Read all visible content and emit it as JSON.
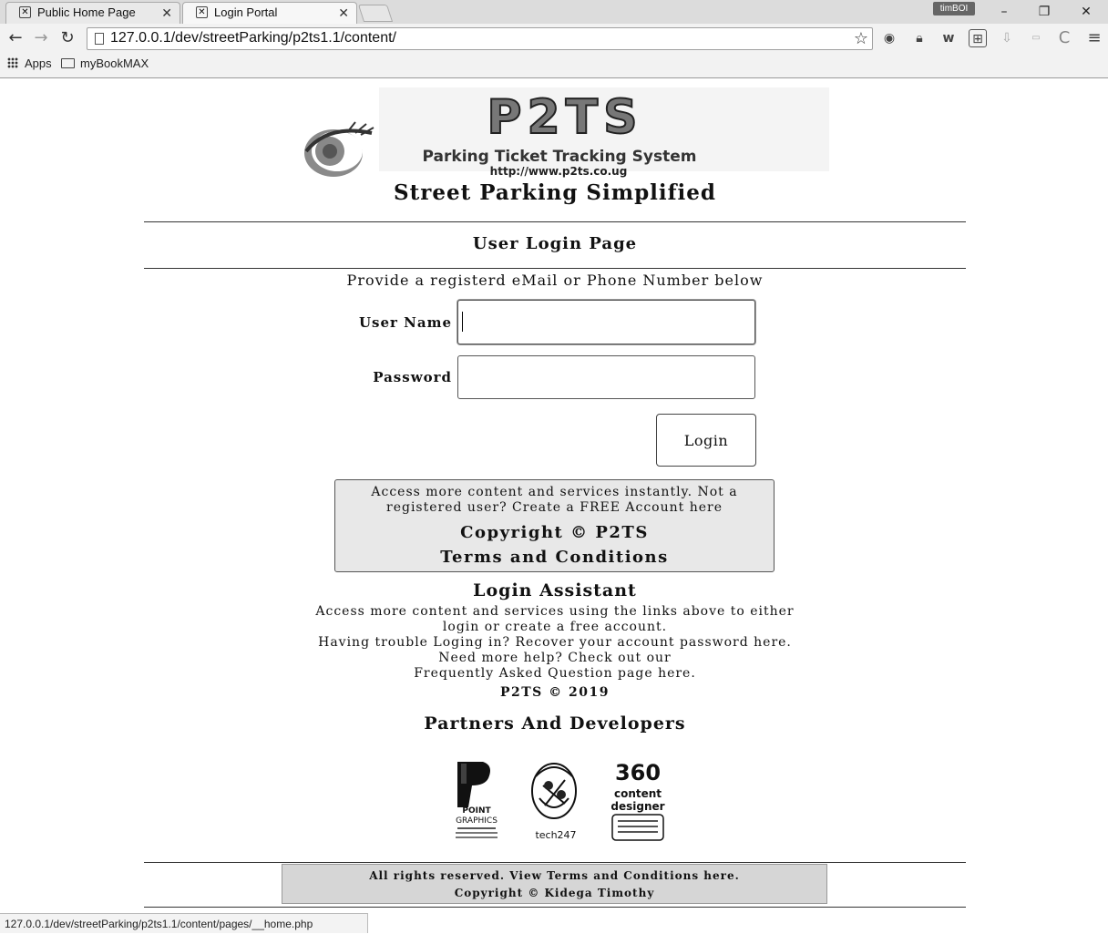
{
  "browser": {
    "tabs": [
      {
        "title": "Public Home Page",
        "active": false
      },
      {
        "title": "Login Portal",
        "active": true
      }
    ],
    "profile_name": "timBOI",
    "url": "127.0.0.1/dev/streetParking/p2ts1.1/content/",
    "bookmarks": [
      {
        "label": "Apps"
      },
      {
        "label": "myBookMAX"
      }
    ],
    "status_url": "127.0.0.1/dev/streetParking/p2ts1.1/content/pages/__home.php"
  },
  "logo": {
    "wordmark": "P2TS",
    "subtitle": "Parking Ticket Tracking System",
    "url": "http://www.p2ts.co.ug"
  },
  "page": {
    "tagline": "Street Parking Simplified",
    "section_title": "User Login Page",
    "instruction": "Provide a registerd eMail or Phone Number below"
  },
  "form": {
    "username_label": "User Name",
    "username_value": "",
    "password_label": "Password",
    "password_value": "",
    "login_button": "Login"
  },
  "infobox": {
    "text": "Access more content and services instantly. Not a registered user? Create a FREE Account here",
    "copyright": "Copyright © P2TS",
    "terms": "Terms and Conditions"
  },
  "assistant": {
    "title": "Login Assistant",
    "lines": [
      "Access more content and services using the links above to either",
      "login or create a free account.",
      "Having trouble Loging in? Recover your account password here.",
      "Need more help? Check out our",
      "Frequently Asked Question page here."
    ],
    "copyright": "P2TS © 2019"
  },
  "partners": {
    "title": "Partners And Developers",
    "items": [
      {
        "name": "POINT GRAPHICS"
      },
      {
        "name": "tech247"
      },
      {
        "name": "360 content designer"
      }
    ]
  },
  "footer": {
    "rights": "All rights reserved. View Terms and Conditions here.",
    "copyright": "Copyright © Kidega Timothy"
  }
}
